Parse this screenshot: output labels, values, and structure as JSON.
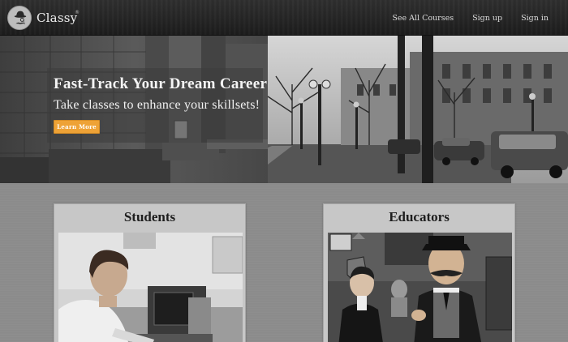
{
  "brand": {
    "name": "Classy",
    "mark": "®",
    "logo_icon": "mustache-bowler-icon"
  },
  "nav": {
    "items": [
      {
        "label": "See All Courses"
      },
      {
        "label": "Sign up"
      },
      {
        "label": "Sign in"
      }
    ]
  },
  "hero": {
    "title": "Fast-Track Your Dream Career",
    "subtitle": "Take classes to enhance your skillsets!",
    "cta_label": "Learn More",
    "cta_color": "#eea236"
  },
  "cards": [
    {
      "title": "Students",
      "photo": "student-at-computer-photo"
    },
    {
      "title": "Educators",
      "photo": "educator-in-gown-photo"
    }
  ],
  "colors": {
    "nav_bg": "#262626",
    "page_bg": "#8c8c8c",
    "card_bg": "#c7c7c7",
    "accent": "#eea236"
  }
}
